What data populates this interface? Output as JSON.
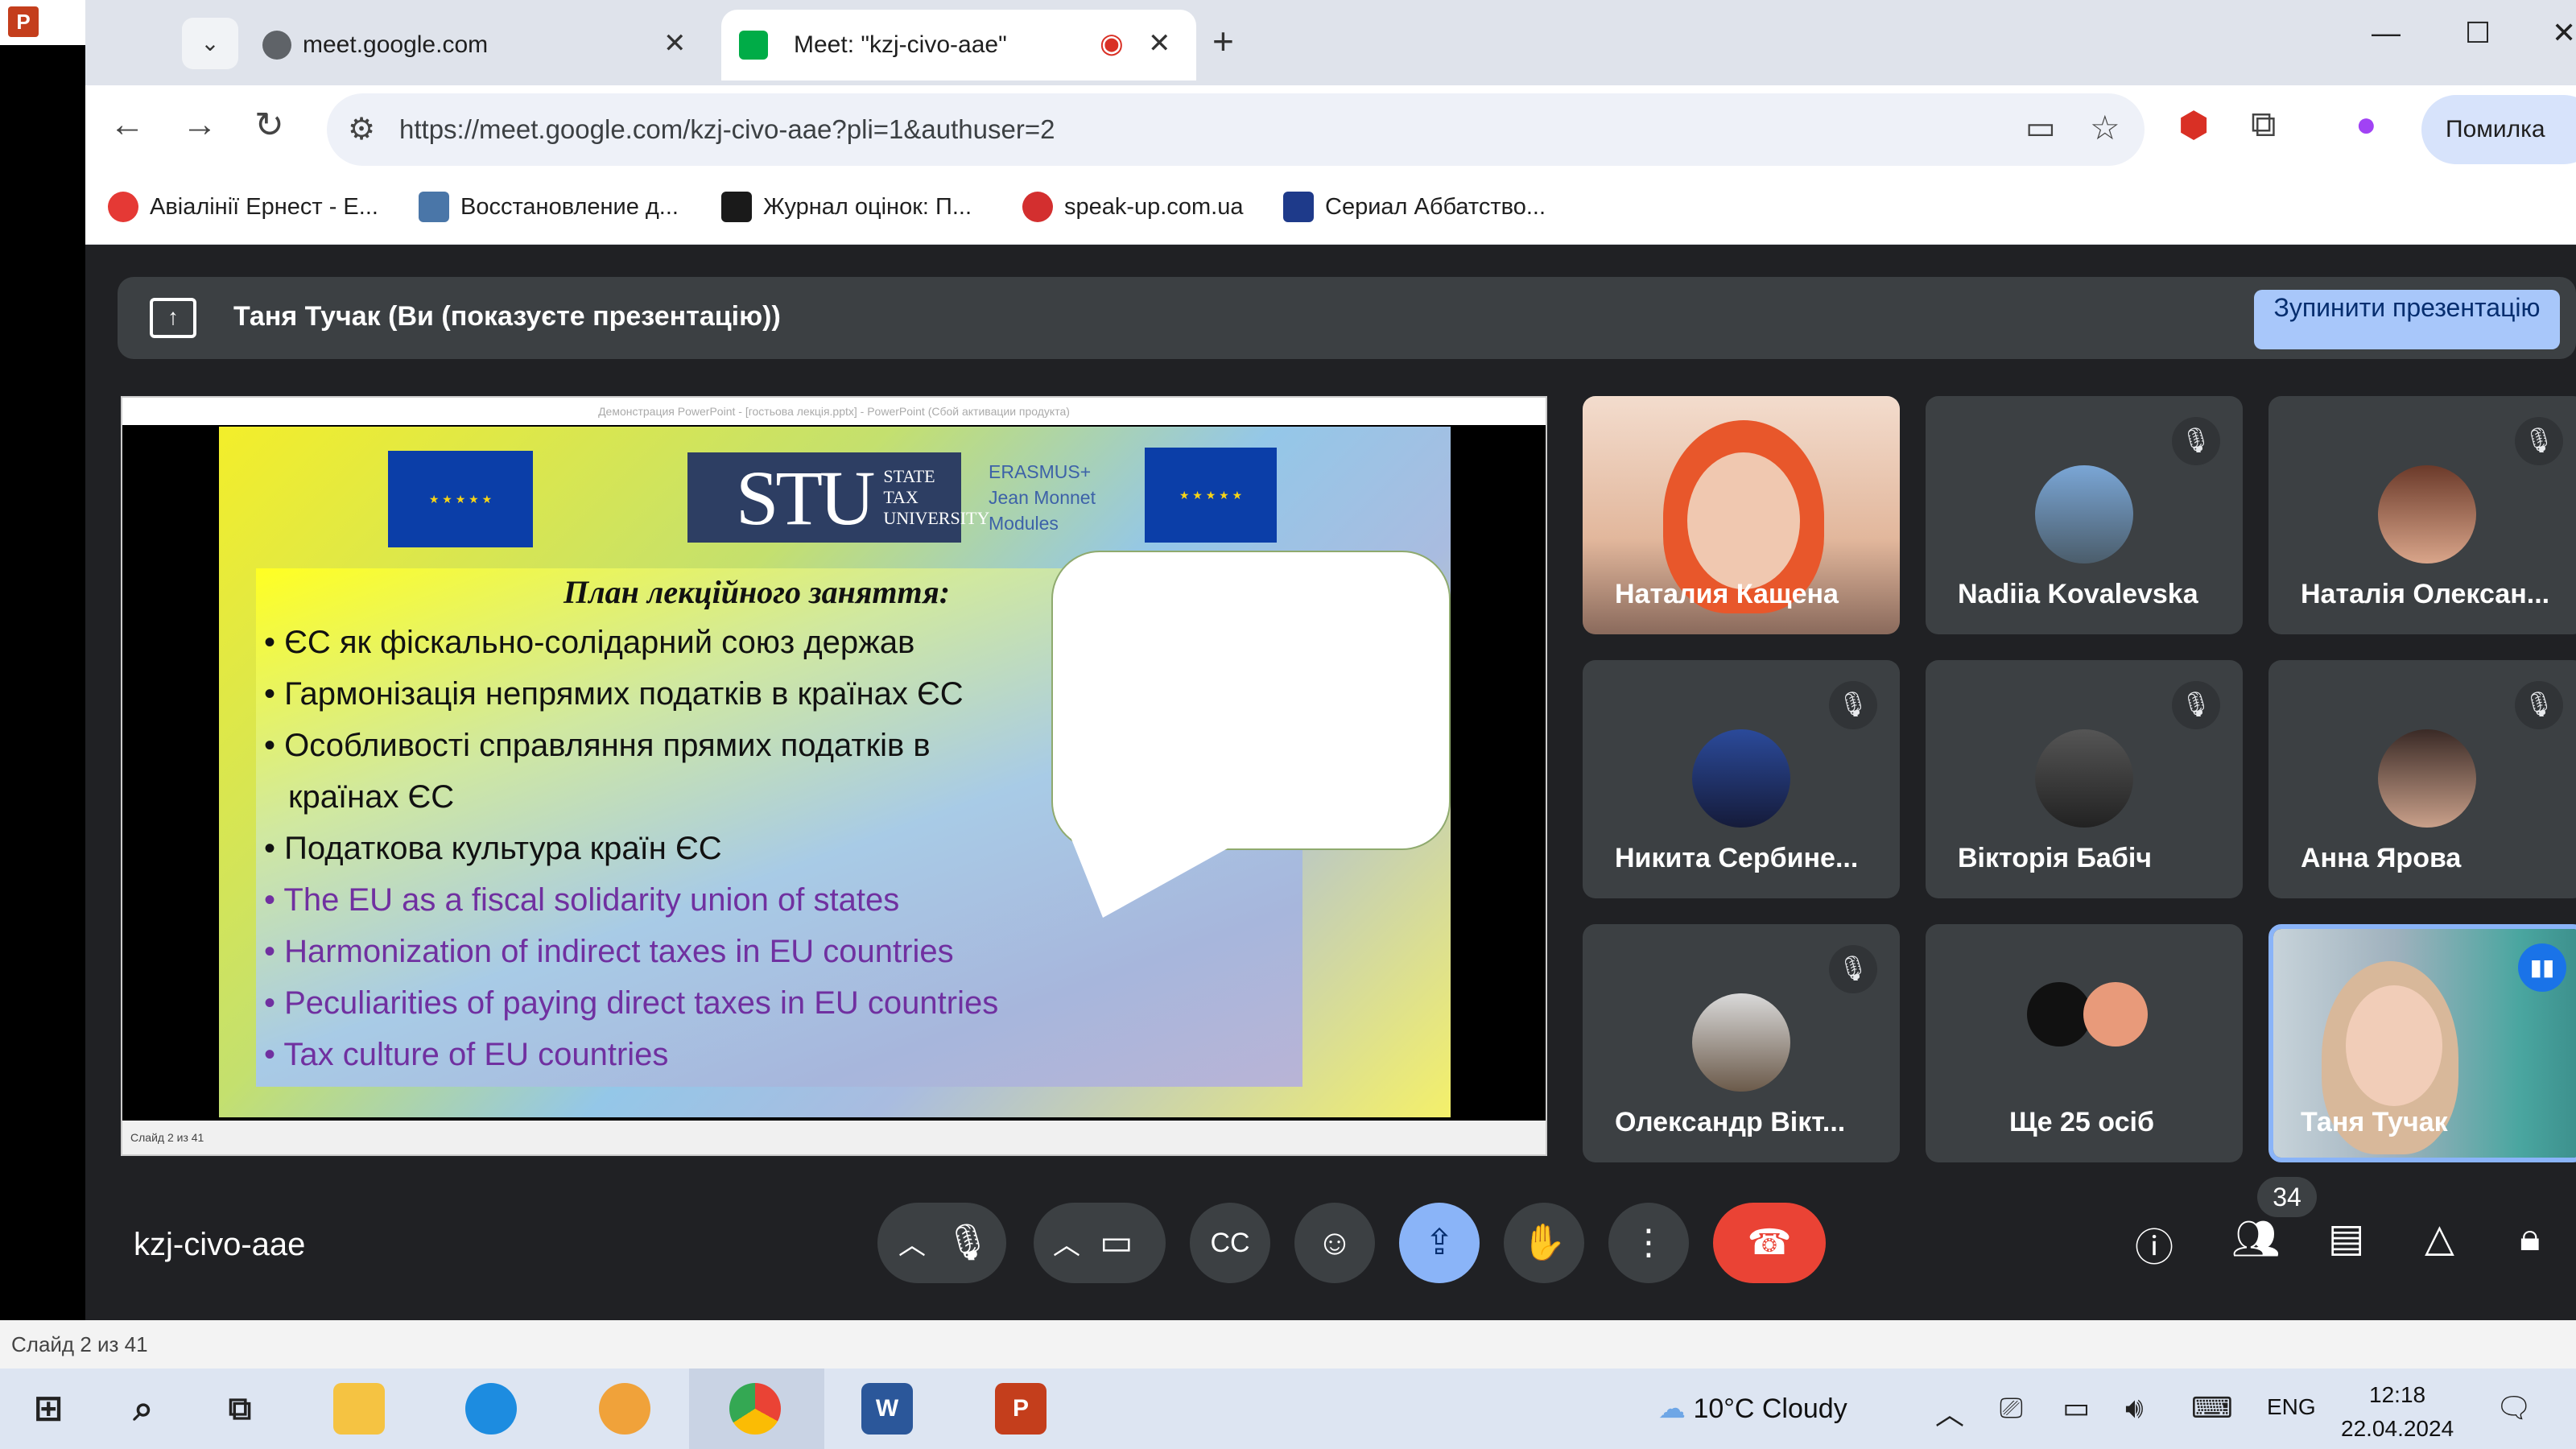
{
  "browser": {
    "tabs": [
      {
        "title": "meet.google.com",
        "active": false
      },
      {
        "title": "Meet: \"kzj-civo-aae\"",
        "active": true
      }
    ],
    "url": "https://meet.google.com/kzj-civo-aae?pli=1&authuser=2",
    "profile_label": "Помилка",
    "bookmarks": [
      {
        "label": "Авіалінії Ернест - E...",
        "color": "#e53935"
      },
      {
        "label": "Восстановление д...",
        "color": "#4a76a8"
      },
      {
        "label": "Журнал оцінок: П...",
        "color": "#1a1a1a"
      },
      {
        "label": "speak-up.com.ua",
        "color": "#d32f2f"
      },
      {
        "label": "Сериал Аббатство...",
        "color": "#1e3a8a"
      }
    ]
  },
  "meet": {
    "presenting_text": "Таня Тучак (Ви (показуєте презентацію))",
    "stop_presenting": "Зупинити презентацію",
    "meeting_code": "kzj-civo-aae",
    "people_count": "34",
    "participants": [
      {
        "name": "Наталия Кащена",
        "muted": false,
        "video": true
      },
      {
        "name": "Nadiia Kovalevska",
        "muted": true,
        "video": false
      },
      {
        "name": "Наталія Олексан...",
        "muted": true,
        "video": false
      },
      {
        "name": "Никита Сербине...",
        "muted": true,
        "video": false
      },
      {
        "name": "Вікторія Бабіч",
        "muted": true,
        "video": false
      },
      {
        "name": "Анна Ярова",
        "muted": true,
        "video": false
      },
      {
        "name": "Олександр Вікт...",
        "muted": true,
        "video": false
      },
      {
        "name": "Ще 25 осіб",
        "muted": false,
        "video": false
      },
      {
        "name": "Таня Тучак",
        "muted": false,
        "video": true,
        "speaking": true
      }
    ]
  },
  "slide": {
    "window_title": "Демонстрация PowerPoint - [гостьова лекція.pptx] - PowerPoint (Сбой активации продукта)",
    "counter": "Слайд 2 из 41",
    "stu_big": "STU",
    "stu_small": [
      "STATE",
      "TAX",
      "UNIVERSITY"
    ],
    "erasmus": [
      "ERASMUS+",
      "Jean Monnet",
      "Modules"
    ],
    "heading": "План лекційного заняття:",
    "bullets_ua": [
      "ЄС як фіскально-солідарний союз держав",
      "Гармонізація непрямих податків в країнах ЄС",
      "Особливості справляння прямих податків в",
      "країнах ЄС",
      "Податкова культура країн ЄС"
    ],
    "bullets_en": [
      "The EU as a fiscal solidarity union of states",
      "Harmonization of indirect taxes in EU countries",
      "Peculiarities of paying direct taxes in EU countries",
      " Tax culture of EU countries"
    ]
  },
  "ppt_status": "Слайд 2 из 41",
  "taskbar": {
    "weather": "10°C  Cloudy",
    "lang": "ENG",
    "time": "12:18",
    "date": "22.04.2024"
  },
  "colors": {
    "meet_bg": "#202124",
    "tile_bg": "#3c4043",
    "accent_blue": "#8ab4f8",
    "hangup_red": "#ea4335",
    "slide_en_text": "#7030a0"
  }
}
